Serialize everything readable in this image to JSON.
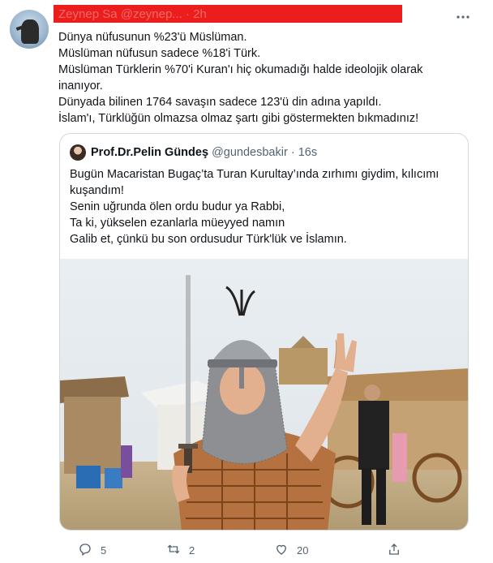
{
  "tweet": {
    "author_redacted": "Zeynep Sa @zeynep... · 2h",
    "lines": [
      "Dünya nüfusunun %23'ü Müslüman.",
      "Müslüman nüfusun sadece %18'i Türk.",
      "Müslüman Türklerin %70'i Kuran'ı hiç okumadığı halde ideolojik olarak",
      "inanıyor.",
      "Dünyada bilinen 1764 savaşın sadece 123'ü din adına yapıldı.",
      "İslam'ı, Türklüğün olmazsa olmaz şartı gibi göstermekten bıkmadınız!"
    ],
    "more_icon": "ellipsis-icon"
  },
  "quote": {
    "name": "Prof.Dr.Pelin Gündeş",
    "handle": "@gundesbakir",
    "dot": "·",
    "time": "16s",
    "lines": [
      "Bugün Macaristan Bugaç’ta Turan Kurultay’ında zırhımı giydim, kılıcımı",
      "kuşandım!",
      "Senin uğrunda ölen ordu budur ya Rabbi,",
      "Ta ki, yükselen ezanlarla müeyyed namın",
      "Galib et, çünkü bu son ordusudur Türk'lük ve İslamın."
    ]
  },
  "actions": {
    "reply_count": "5",
    "retweet_count": "2",
    "like_count": "20"
  },
  "colors": {
    "text": "#0f1419",
    "secondary": "#536471",
    "border": "#cfd9de",
    "redaction": "#ec1d1d"
  }
}
